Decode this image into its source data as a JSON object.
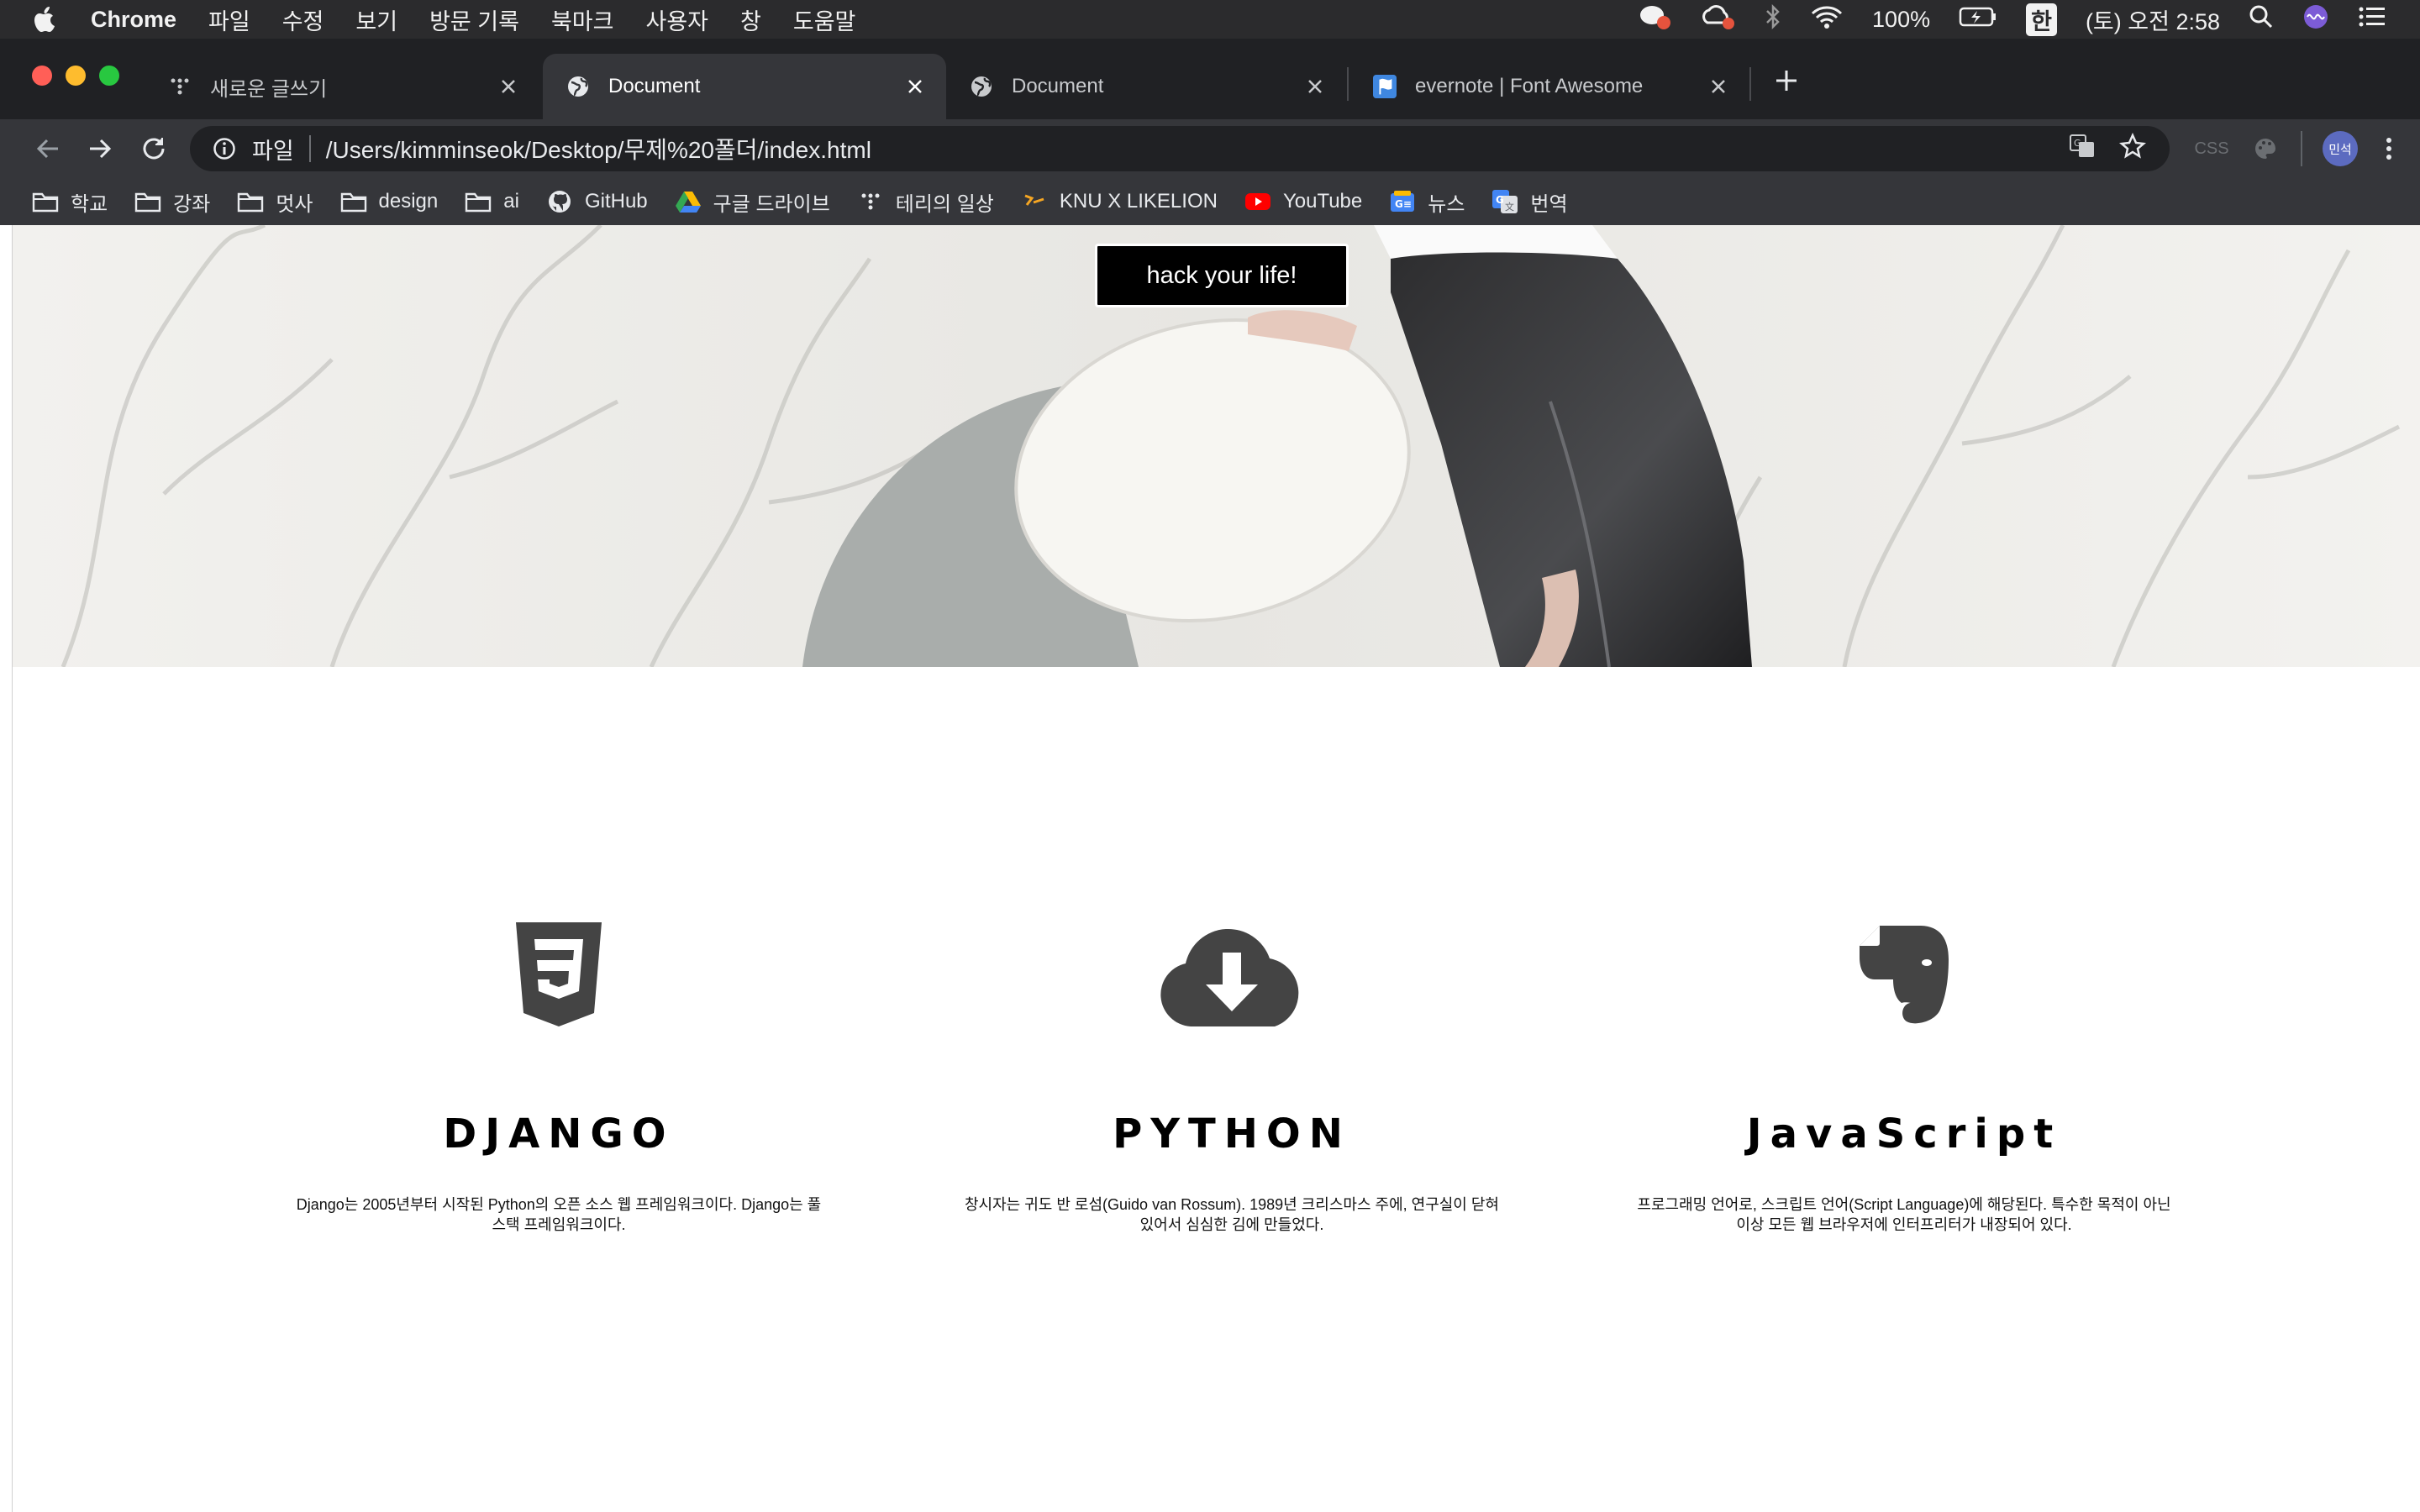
{
  "menubar": {
    "app": "Chrome",
    "items": [
      "파일",
      "수정",
      "보기",
      "방문 기록",
      "북마크",
      "사용자",
      "창",
      "도움말"
    ],
    "battery": "100%",
    "input_lang": "한",
    "clock": "(토) 오전 2:58"
  },
  "tabs": [
    {
      "label": "새로운 글쓰기",
      "icon": "tistory-icon",
      "active": false
    },
    {
      "label": "Document",
      "icon": "globe-icon",
      "active": true
    },
    {
      "label": "Document",
      "icon": "globe-icon",
      "active": false
    },
    {
      "label": "evernote | Font Awesome",
      "icon": "font-awesome-flag-icon",
      "active": false
    }
  ],
  "toolbar": {
    "scheme": "파일",
    "url": "/Users/kimminseok/Desktop/무제%20폴더/index.html",
    "ext_css": "CSS",
    "avatar": "민석"
  },
  "bookmarks": [
    {
      "label": "학교",
      "icon": "folder-icon"
    },
    {
      "label": "강좌",
      "icon": "folder-icon"
    },
    {
      "label": "멋사",
      "icon": "folder-icon"
    },
    {
      "label": "design",
      "icon": "folder-icon"
    },
    {
      "label": "ai",
      "icon": "folder-icon"
    },
    {
      "label": "GitHub",
      "icon": "github-icon"
    },
    {
      "label": "구글 드라이브",
      "icon": "google-drive-icon"
    },
    {
      "label": "테리의 일상",
      "icon": "tistory-icon"
    },
    {
      "label": "KNU X LIKELION",
      "icon": "likelion-icon"
    },
    {
      "label": "YouTube",
      "icon": "youtube-icon"
    },
    {
      "label": "뉴스",
      "icon": "google-news-icon"
    },
    {
      "label": "번역",
      "icon": "google-translate-icon"
    }
  ],
  "page": {
    "hero_button": "hack your life!",
    "features": [
      {
        "title": "DJANGO",
        "icon": "css3-icon",
        "desc": "Django는 2005년부터 시작된 Python의 오픈 소스 웹 프레임워크이다. Django는 풀 스택 프레임워크이다."
      },
      {
        "title": "PYTHON",
        "icon": "cloud-download-icon",
        "desc": "창시자는 귀도 반 로섬(Guido van Rossum). 1989년 크리스마스 주에, 연구실이 닫혀있어서 심심한 김에 만들었다."
      },
      {
        "title": "JavaScript",
        "icon": "evernote-icon",
        "desc": "프로그래밍 언어로, 스크립트 언어(Script Language)에 해당된다. 특수한 목적이 아닌 이상 모든 웹 브라우저에 인터프리터가 내장되어 있다."
      }
    ]
  },
  "colors": {
    "menubar_bg": "#2b2b2d",
    "tabstrip_bg": "#202124",
    "toolbar_bg": "#35363a",
    "icon_gray": "#444444",
    "hero_button_bg": "#000000"
  }
}
